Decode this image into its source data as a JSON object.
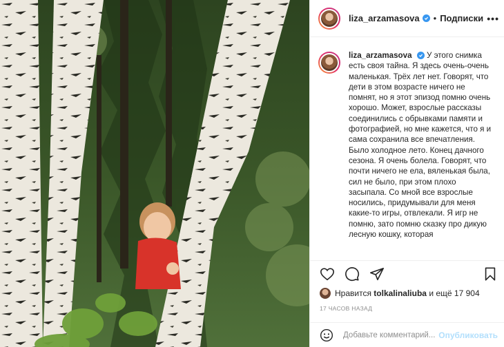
{
  "post": {
    "username": "liza_arzamasova",
    "separator": "•",
    "follow_label": "Подписки",
    "more_label": "•••",
    "caption": "У этого снимка есть своя тайна. Я здесь очень-очень маленькая. Трёх лет нет. Говорят, что дети в этом возрасте ничего не помнят, но я этот эпизод помню очень хорошо. Может, взрослые рассказы соединились с обрывками памяти и фотографией, но мне кажется, что я и сама сохранила все впечатления. Было холодное лето. Конец дачного сезона. Я очень болела. Говорят, что почти ничего не ела, вяленькая была, сил не было, при этом плохо засыпала. Со мной все взрослые носились, придумывали для меня какие-то игры, отвлекали. Я игр не помню, зато помню сказку про дикую лесную кошку, которая"
  },
  "likes": {
    "prefix": "Нравится",
    "user": "tolkalinaliuba",
    "suffix": "и ещё 17 904"
  },
  "time_ago": "17 ЧАСОВ НАЗАД",
  "comment": {
    "placeholder": "Добавьте комментарий...",
    "publish_label": "Опубликовать"
  },
  "colors": {
    "verified": "#3897f0",
    "publish_disabled": "#b2dffc",
    "muted": "#8e8e8e"
  },
  "icons": [
    "heart-icon",
    "comment-icon",
    "share-icon",
    "bookmark-icon",
    "emoji-icon",
    "verified-icon"
  ]
}
